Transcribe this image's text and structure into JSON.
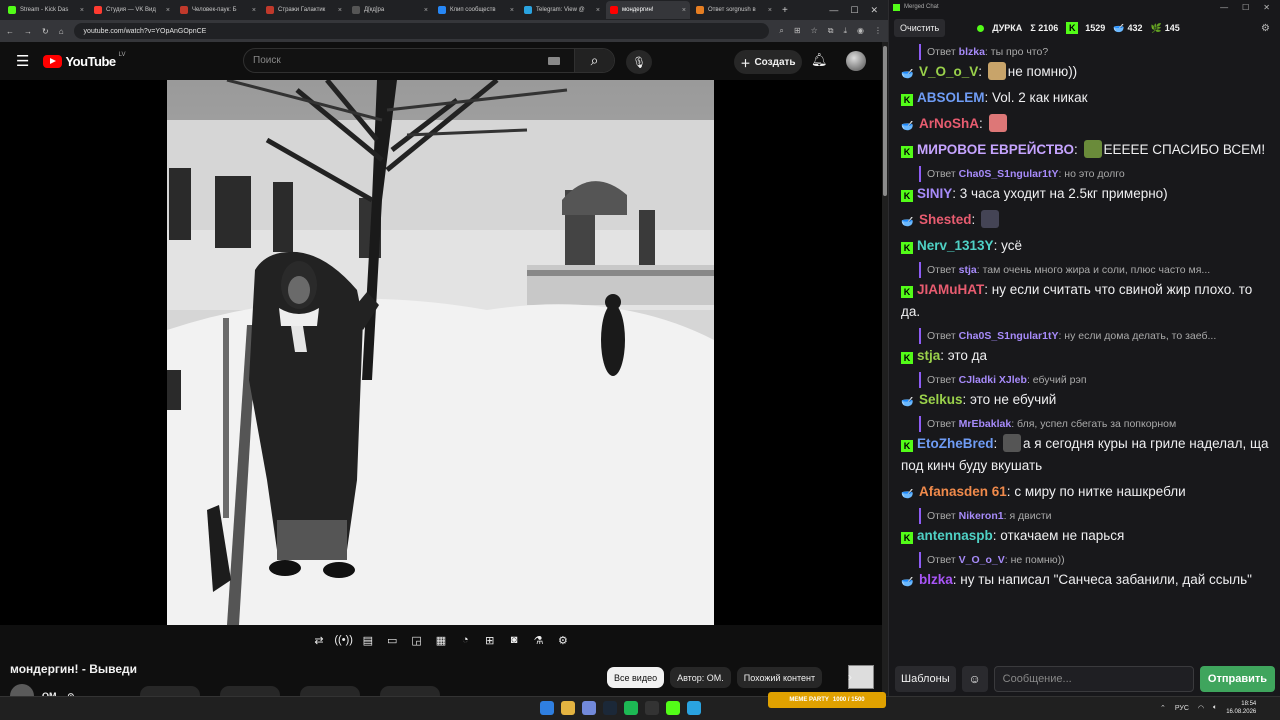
{
  "browser": {
    "tabs": [
      {
        "label": "Stream - Kick Das",
        "color": "#53fc18"
      },
      {
        "label": "Студия — VK Вид",
        "color": "#ff3b30"
      },
      {
        "label": "Человек-паук: Б",
        "color": "#c0392b"
      },
      {
        "label": "Стражи Галактик",
        "color": "#c0392b"
      },
      {
        "label": "Д[кд]ра",
        "color": "#555"
      },
      {
        "label": "Клип сообществ",
        "color": "#2787f5"
      },
      {
        "label": "Telegram: View @",
        "color": "#2aa3e0"
      },
      {
        "label": "мондергин!",
        "color": "#ff0000"
      },
      {
        "label": "Ответ sorgnush в",
        "color": "#e67e22"
      }
    ],
    "url": "youtube.com/watch?v=YOpAnGOpnCE"
  },
  "youtube": {
    "logo": "YouTube",
    "region": "LV",
    "search_placeholder": "Поиск",
    "create_label": "Создать",
    "video_title": "мондергин! - Выведи",
    "channel_name": "OM.",
    "chips": [
      "Все видео",
      "Автор: OM.",
      "Похожий контент"
    ]
  },
  "chat": {
    "window_title": "Merged Chat",
    "clear_label": "Очистить",
    "channel": "ДУРКА",
    "stats": {
      "total": "Σ 2106",
      "kick": "1529",
      "twitch": "432",
      "yt": "145"
    },
    "messages": [
      {
        "reply": "blzka",
        "reply_text": "ты про что?"
      },
      {
        "user": "V_O_o_V",
        "color": "#9ad14b",
        "text": "не помню))",
        "platform": "p",
        "emote": "#c8a46a"
      },
      {
        "user": "ABSOLEM",
        "color": "#6f9cf5",
        "text": "Vol. 2 как никак",
        "platform": "k"
      },
      {
        "user": "ArNoShA",
        "color": "#e85c70",
        "text": "",
        "platform": "p",
        "emote": "#d77"
      },
      {
        "user": "МИРОВОЕ ЕВРЕЙСТВО",
        "color": "#c6a4ff",
        "text": "ЕЕЕЕЕ СПАСИБО ВСЕМ!",
        "platform": "k",
        "emote": "#6a8b3a"
      },
      {
        "reply": "Cha0S_S1ngular1tY",
        "reply_text": "но это долго"
      },
      {
        "user": "SINIY",
        "color": "#a78bfa",
        "text": "3 часа уходит на 2.5кг примерно)",
        "platform": "k"
      },
      {
        "user": "Shested",
        "color": "#e85c70",
        "text": "",
        "platform": "p",
        "emote": "#445"
      },
      {
        "user": "Nerv_1313Y",
        "color": "#4fd1c5",
        "text": "усё",
        "platform": "k"
      },
      {
        "reply": "stja",
        "reply_text": "там очень много жира и соли, плюс часто мя..."
      },
      {
        "user": "JIAMuHAT",
        "color": "#e85c70",
        "text": "ну если считать что свиной жир плохо. то да.",
        "platform": "k"
      },
      {
        "reply": "Cha0S_S1ngular1tY",
        "reply_text": "ну если дома делать, то заеб..."
      },
      {
        "user": "stja",
        "color": "#9ad14b",
        "text": "это да",
        "platform": "k"
      },
      {
        "reply": "CJladki XJleb",
        "reply_text": "ебучий рэп"
      },
      {
        "user": "Selkus",
        "color": "#9ad14b",
        "text": "это не ебучий",
        "platform": "p"
      },
      {
        "reply": "MrEbaklak",
        "reply_text": "бля, успел сбегать за попкорном"
      },
      {
        "user": "EtoZheBred",
        "color": "#6f9cf5",
        "text": "а я сегодня куры на гриле наделал, ща под кинч буду вкушать",
        "platform": "k",
        "emote": "#555"
      },
      {
        "user": "Afanasden 61",
        "color": "#f08a4b",
        "text": "с миру по нитке нашкребли",
        "platform": "p"
      },
      {
        "reply": "Nikeron1",
        "reply_text": "я двисти"
      },
      {
        "user": "antennaspb",
        "color": "#4fd1c5",
        "text": "откачаем не парься",
        "platform": "k"
      },
      {
        "reply": "V_O_o_V",
        "reply_text": "не помню))"
      },
      {
        "user": "blzka",
        "color": "#a855f7",
        "text": "ну ты написал \"Санчеса забанили, дай ссыль\"",
        "platform": "p"
      }
    ],
    "templates_label": "Шаблоны",
    "input_placeholder": "Сообщение...",
    "send_label": "Отправить"
  },
  "taskbar": {
    "meme_label": "MEME PARTY",
    "meme_progress": "1000 / 1500",
    "lang": "РУС",
    "time": "18:54",
    "date": "16.08.2026"
  }
}
